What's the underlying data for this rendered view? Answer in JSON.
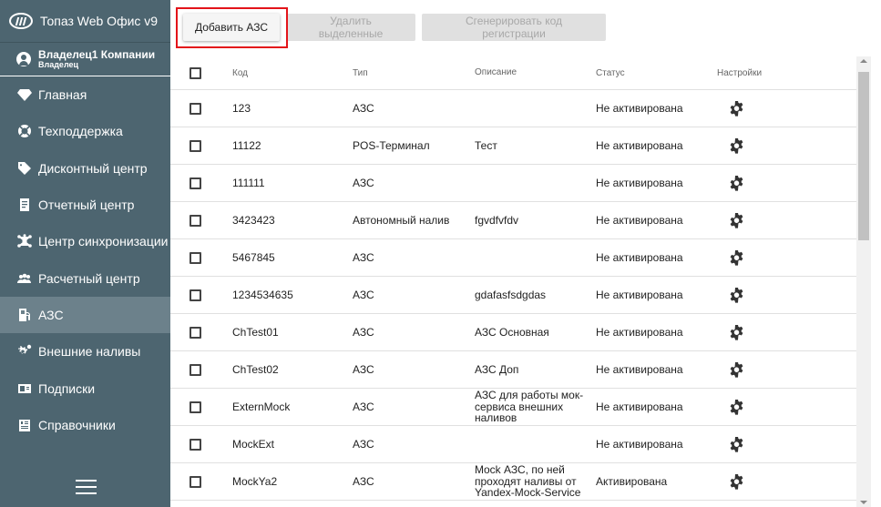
{
  "app": {
    "title": "Топаз Web Офис v9"
  },
  "user": {
    "name": "Владелец1 Компании",
    "role": "Владелец"
  },
  "sidebar": {
    "items": [
      {
        "label": "Главная",
        "icon": "diamond-icon"
      },
      {
        "label": "Техподдержка",
        "icon": "lifebuoy-icon"
      },
      {
        "label": "Дисконтный центр",
        "icon": "tag-icon"
      },
      {
        "label": "Отчетный центр",
        "icon": "report-icon"
      },
      {
        "label": "Центр синхронизации",
        "icon": "sync-network-icon"
      },
      {
        "label": "Расчетный центр",
        "icon": "users-icon"
      },
      {
        "label": "АЗС",
        "icon": "fuel-station-icon",
        "active": true
      },
      {
        "label": "Внешние наливы",
        "icon": "gears-icon"
      },
      {
        "label": "Подписки",
        "icon": "id-card-icon"
      },
      {
        "label": "Справочники",
        "icon": "book-icon"
      }
    ]
  },
  "toolbar": {
    "add_label": "Добавить АЗС",
    "delete_label": "Удалить выделенные",
    "generate_label": "Сгенерировать код регистрации"
  },
  "table": {
    "headers": {
      "code": "Код",
      "type": "Тип",
      "description": "Описание",
      "status": "Статус",
      "settings": "Настройки"
    },
    "rows": [
      {
        "code": "123",
        "type": "АЗС",
        "description": "",
        "status": "Не активирована"
      },
      {
        "code": "11122",
        "type": "POS-Терминал",
        "description": "Тест",
        "status": "Не активирована"
      },
      {
        "code": "111111",
        "type": "АЗС",
        "description": "",
        "status": "Не активирована"
      },
      {
        "code": "3423423",
        "type": "Автономный налив",
        "description": "fgvdfvfdv",
        "status": "Не активирована"
      },
      {
        "code": "5467845",
        "type": "АЗС",
        "description": "",
        "status": "Не активирована"
      },
      {
        "code": "1234534635",
        "type": "АЗС",
        "description": "gdafasfsdgdas",
        "status": "Не активирована"
      },
      {
        "code": "ChTest01",
        "type": "АЗС",
        "description": "АЗС Основная",
        "status": "Не активирована"
      },
      {
        "code": "ChTest02",
        "type": "АЗС",
        "description": "АЗС Доп",
        "status": "Не активирована"
      },
      {
        "code": "ExternMock",
        "type": "АЗС",
        "description": "АЗС для работы мок-сервиса внешних наливов",
        "status": "Не активирована"
      },
      {
        "code": "MockExt",
        "type": "АЗС",
        "description": "",
        "status": "Не активирована"
      },
      {
        "code": "MockYa2",
        "type": "АЗС",
        "description": "Mock АЗС, по ней проходят наливы от Yandex-Mock-Service",
        "status": "Активирована"
      }
    ]
  },
  "colors": {
    "sidebar_bg": "#4d6570",
    "sidebar_active": "#6c818b",
    "highlight_border": "#e3141a"
  }
}
